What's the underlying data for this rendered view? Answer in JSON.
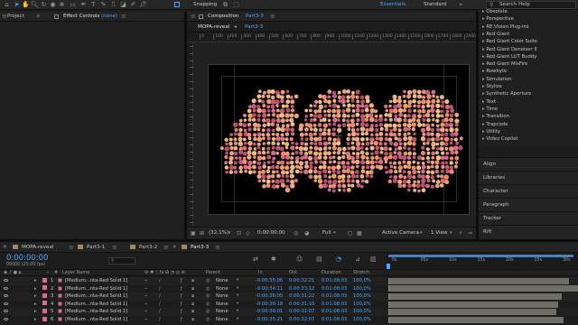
{
  "toolbar": {
    "snapping": "Snapping",
    "workspaces": [
      "Essentials",
      "Standard"
    ],
    "search_placeholder": "Search Help"
  },
  "project_panel": {
    "tab": "Project"
  },
  "effect_controls_panel": {
    "tab": "Effect Controls",
    "target": "(none)"
  },
  "composition_panel": {
    "tab_prefix": "Composition",
    "comp_name": "Part3-3",
    "breadcrumb": [
      "MOPA-reveal",
      "Part3-3"
    ],
    "ruler_ticks": [
      "0",
      "100",
      "200",
      "300",
      "400",
      "500",
      "600",
      "700",
      "800",
      "900",
      "1000",
      "1100",
      "1200",
      "1300",
      "1400",
      "1500",
      "1600",
      "1700",
      "1800",
      "1900"
    ],
    "canvas_text": "400",
    "footer": {
      "zoom": "(32,1%)",
      "timecode": "0:00:00:00",
      "resolution": "Full",
      "camera": "Active Camera",
      "view": "1 View"
    }
  },
  "effects_list": {
    "items": [
      "Obsolete",
      "Perspective",
      "RE:Vision Plug-ins",
      "Red Giant",
      "Red Giant Color Suite",
      "Red Giant Denoiser II",
      "Red Giant LUT Buddy",
      "Red Giant MisFire",
      "Rowbyte",
      "Simulation",
      "Stylize",
      "Synthetic Aperture",
      "Text",
      "Time",
      "Transition",
      "Trapcode",
      "Utility",
      "Video Copilot"
    ]
  },
  "side_panels": [
    "Align",
    "Libraries",
    "Character",
    "Paragraph",
    "Tracker",
    "Rift"
  ],
  "timeline": {
    "tabs": [
      "MOPA-reveal",
      "Part3-1",
      "Part3-2",
      "Part3-3"
    ],
    "timecode": "0:00:00:00",
    "frame_info": "00000 (25.00 fps)",
    "ruler": [
      "0s",
      "05s",
      "10s",
      "15s",
      "20s",
      "25s",
      "30s"
    ],
    "columns": {
      "layer_name": "Layer Name",
      "parent": "Parent",
      "in": "In",
      "out": "Out",
      "duration": "Duration",
      "stretch": "Stretch"
    },
    "layers": [
      {
        "num": "1",
        "name": "[Medium...nta-Red Solid 1]",
        "parent": "None",
        "in": "-0:00:35:06",
        "out": "0:00:32:21",
        "duration": "0:01:08:03",
        "stretch": "100,0%"
      },
      {
        "num": "2",
        "name": "[Medium...nta-Red Solid 1]",
        "parent": "None",
        "in": "-0:00:34:11",
        "out": "0:00:33:12",
        "duration": "0:01:08:03",
        "stretch": "100,0%"
      },
      {
        "num": "3",
        "name": "[Medium...nta-Red Solid 1]",
        "parent": "None",
        "in": "-0:00:36:05",
        "out": "0:00:31:22",
        "duration": "0:01:08:03",
        "stretch": "100,0%"
      },
      {
        "num": "4",
        "name": "[Medium...nta-Red Solid 1]",
        "parent": "None",
        "in": "-0:00:36:18",
        "out": "0:00:31:10",
        "duration": "0:01:08:03",
        "stretch": "100,0%"
      },
      {
        "num": "5",
        "name": "[Medium...nta-Red Solid 1]",
        "parent": "None",
        "in": "-0:00:36:01",
        "out": "0:00:31:07",
        "duration": "0:01:08:03",
        "stretch": "100,0%"
      },
      {
        "num": "6",
        "name": "[Medium...nta-Red Solid 1]",
        "parent": "None",
        "in": "-0:00:35:21",
        "out": "0:00:32:07",
        "duration": "0:01:08:03",
        "stretch": "100,0%"
      }
    ]
  },
  "colors": {
    "accent": "#4aa6ff",
    "label_pink": "#d86e8c",
    "dot_palette": [
      "#e8a06a",
      "#f2c27a",
      "#d96b8a",
      "#c2577e",
      "#f08a6c",
      "#e7b07c",
      "#b8506e",
      "#f3a77d"
    ]
  }
}
